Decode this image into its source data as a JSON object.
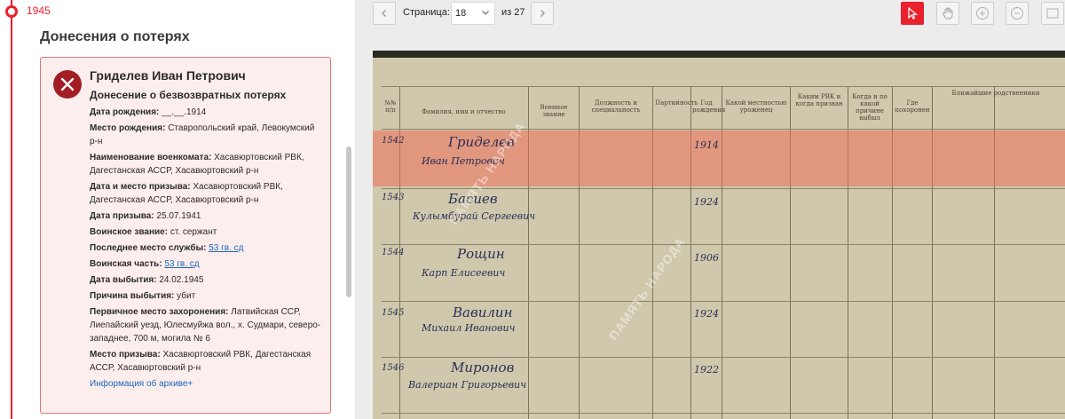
{
  "timeline": {
    "year": "1945"
  },
  "section": {
    "title": "Донесения о потерях"
  },
  "card": {
    "name": "Гриделев Иван Петрович",
    "doc_type": "Донесение о безвозвратных потерях",
    "fields": [
      {
        "label": "Дата рождения:",
        "value": "__.__.1914"
      },
      {
        "label": "Место рождения:",
        "value": "Ставропольский край, Левокумский р-н"
      },
      {
        "label": "Наименование военкомата:",
        "value": "Хасавюртовский РВК, Дагестанская АССР, Хасавюртовский р-н"
      },
      {
        "label": "Дата и место призыва:",
        "value": "Хасавюртовский РВК, Дагестанская АССР, Хасавюртовский р-н"
      },
      {
        "label": "Дата призыва:",
        "value": "25.07.1941"
      },
      {
        "label": "Воинское звание:",
        "value": "ст. сержант"
      },
      {
        "label": "Последнее место службы:",
        "link": "53 гв. сд"
      },
      {
        "label": "Воинская часть:",
        "link": "53 гв. сд"
      },
      {
        "label": "Дата выбытия:",
        "value": "24.02.1945"
      },
      {
        "label": "Причина выбытия:",
        "value": "убит"
      },
      {
        "label": "Первичное место захоронения:",
        "value": "Латвийская ССР, Лиепайский уезд, Юлесмуйжа вол., х. Судмари, северо-западнее, 700 м, могила № 6"
      },
      {
        "label": "Место призыва:",
        "value": "Хасавюртовский РВК, Дагестанская АССР, Хасавюртовский р-н"
      }
    ],
    "archive_link": "Информация об архиве+"
  },
  "viewer": {
    "page_label": "Страница:",
    "page_value": "18",
    "page_of": "из 27"
  },
  "document": {
    "headers": [
      "№№ п/п",
      "Фамилия, имя и отчество",
      "Военное звание",
      "Должность и специальность",
      "Партийность",
      "Год рождения",
      "Какой местностью уроженец",
      "Каким РВК и когда призван",
      "Когда и по какой причине выбыл",
      "Где похоронен",
      "Ближайшие родственники"
    ],
    "rows": [
      {
        "num": "1542",
        "surname": "Гриделев",
        "given": "Иван Петрович",
        "year": "1914"
      },
      {
        "num": "1543",
        "surname": "Басиев",
        "given": "Кулымбурай Сергеевич",
        "year": "1924"
      },
      {
        "num": "1544",
        "surname": "Рощин",
        "given": "Карп Елисеевич",
        "year": "1906"
      },
      {
        "num": "1545",
        "surname": "Вавилин",
        "given": "Михаил Иванович",
        "year": "1924"
      },
      {
        "num": "1546",
        "surname": "Миронов",
        "given": "Валериан Григорьевич",
        "year": "1922"
      }
    ],
    "watermark": "ПАМЯТЬ НАРОДА"
  },
  "colors": {
    "accent": "#e8212c",
    "card_bg": "#fdeeee",
    "link": "#1a65b8"
  }
}
